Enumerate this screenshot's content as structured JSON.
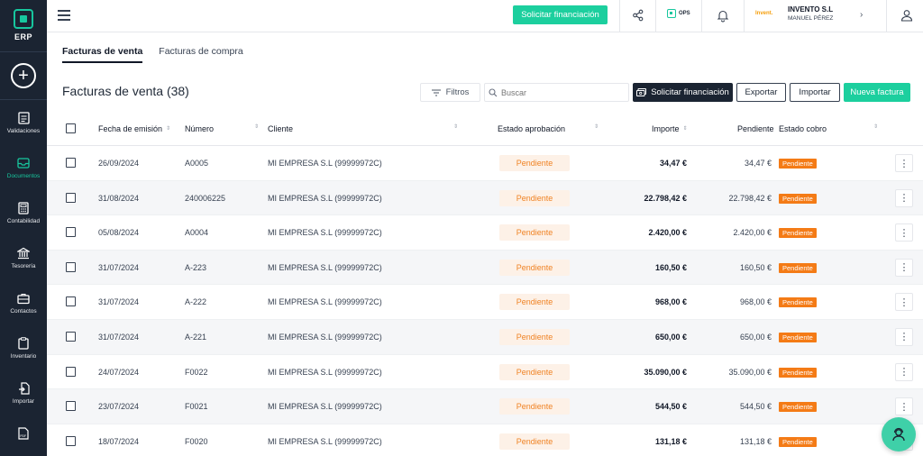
{
  "app": {
    "logo_text": "ERP"
  },
  "sidebar": {
    "items": [
      {
        "label": "Validaciones",
        "icon": "checklist-icon",
        "active": false
      },
      {
        "label": "Documentos",
        "icon": "inbox-icon",
        "active": true
      },
      {
        "label": "Contabilidad",
        "icon": "calculator-icon",
        "active": false
      },
      {
        "label": "Tesorería",
        "icon": "bank-icon",
        "active": false
      },
      {
        "label": "Contactos",
        "icon": "briefcase-icon",
        "active": false
      },
      {
        "label": "Inventario",
        "icon": "clipboard-icon",
        "active": false
      },
      {
        "label": "Importar",
        "icon": "import-icon",
        "active": false
      },
      {
        "label": "",
        "icon": "pdf-file-icon",
        "active": false
      }
    ]
  },
  "header": {
    "financing_label": "Solicitar financiación",
    "ops_label": "OPS",
    "company_logo_text": "Invent.",
    "company_name": "INVENTO S.L",
    "user_name": "MANUEL PÉREZ"
  },
  "tabs": [
    {
      "label": "Facturas de venta",
      "active": true
    },
    {
      "label": "Facturas de compra",
      "active": false
    }
  ],
  "toolbar": {
    "title": "Facturas de venta (38)",
    "filters_label": "Filtros",
    "search_placeholder": "Buscar",
    "financing_label": "Solicitar financiación",
    "export_label": "Exportar",
    "import_label": "Importar",
    "new_label": "Nueva factura"
  },
  "table": {
    "columns": {
      "date": "Fecha de emisión",
      "number": "Número",
      "client": "Cliente",
      "approval": "Estado aprobación",
      "amount": "Importe",
      "pending": "Pendiente",
      "collection": "Estado cobro"
    },
    "rows": [
      {
        "date": "26/09/2024",
        "number": "A0005",
        "client": "MI EMPRESA S.L (99999972C)",
        "approval": "Pendiente",
        "amount": "34,47 €",
        "pending": "34,47 €",
        "collection": "Pendiente"
      },
      {
        "date": "31/08/2024",
        "number": "240006225",
        "client": "MI EMPRESA S.L (99999972C)",
        "approval": "Pendiente",
        "amount": "22.798,42 €",
        "pending": "22.798,42 €",
        "collection": "Pendiente"
      },
      {
        "date": "05/08/2024",
        "number": "A0004",
        "client": "MI EMPRESA S.L (99999972C)",
        "approval": "Pendiente",
        "amount": "2.420,00 €",
        "pending": "2.420,00 €",
        "collection": "Pendiente"
      },
      {
        "date": "31/07/2024",
        "number": "A-223",
        "client": "MI EMPRESA S.L (99999972C)",
        "approval": "Pendiente",
        "amount": "160,50 €",
        "pending": "160,50 €",
        "collection": "Pendiente"
      },
      {
        "date": "31/07/2024",
        "number": "A-222",
        "client": "MI EMPRESA S.L (99999972C)",
        "approval": "Pendiente",
        "amount": "968,00 €",
        "pending": "968,00 €",
        "collection": "Pendiente"
      },
      {
        "date": "31/07/2024",
        "number": "A-221",
        "client": "MI EMPRESA S.L (99999972C)",
        "approval": "Pendiente",
        "amount": "650,00 €",
        "pending": "650,00 €",
        "collection": "Pendiente"
      },
      {
        "date": "24/07/2024",
        "number": "F0022",
        "client": "MI EMPRESA S.L (99999972C)",
        "approval": "Pendiente",
        "amount": "35.090,00 €",
        "pending": "35.090,00 €",
        "collection": "Pendiente"
      },
      {
        "date": "23/07/2024",
        "number": "F0021",
        "client": "MI EMPRESA S.L (99999972C)",
        "approval": "Pendiente",
        "amount": "544,50 €",
        "pending": "544,50 €",
        "collection": "Pendiente"
      },
      {
        "date": "18/07/2024",
        "number": "F0020",
        "client": "MI EMPRESA S.L (99999972C)",
        "approval": "Pendiente",
        "amount": "131,18 €",
        "pending": "131,18 €",
        "collection": "Pendiente"
      }
    ]
  },
  "colors": {
    "sidebar_bg": "#1b2432",
    "accent": "#1ccf9e",
    "pending_badge": "#f47b16",
    "approval_text": "#f08324"
  }
}
